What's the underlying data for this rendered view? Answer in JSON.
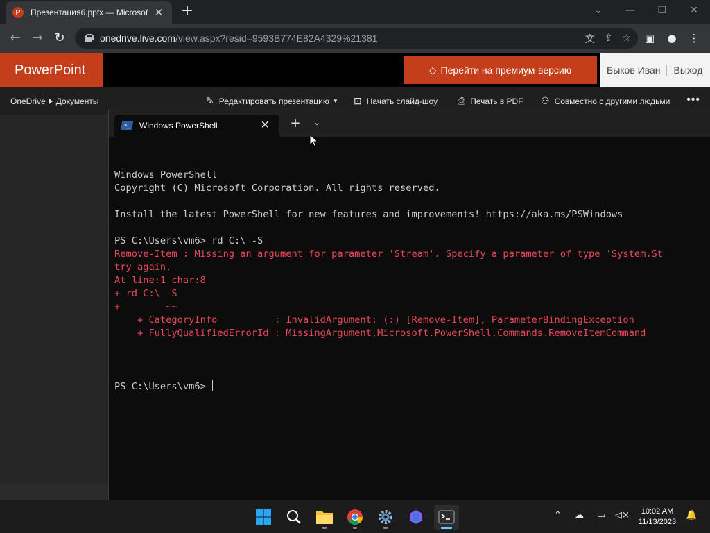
{
  "browser": {
    "tab_title": "Презентация6.pptx — Microsoft",
    "favicon_letter": "P",
    "url_host": "onedrive.live.com",
    "url_path": "/view.aspx?resid=9593B774E82A4329%21381"
  },
  "ppt": {
    "brand": "PowerPoint",
    "premium_label": "Перейти на премиум-версию",
    "user_name": "Быков Иван",
    "logout_label": "Выход"
  },
  "commandbar": {
    "breadcrumb": [
      "OneDrive",
      "Документы"
    ],
    "edit_label": "Редактировать презентацию",
    "slideshow_label": "Начать слайд-шоу",
    "print_label": "Печать в PDF",
    "share_label": "Совместно с другими людьми"
  },
  "terminal": {
    "tab_title": "Windows PowerShell",
    "lines": [
      {
        "text": "Windows PowerShell",
        "color": "w"
      },
      {
        "text": "Copyright (C) Microsoft Corporation. All rights reserved.",
        "color": "w"
      },
      {
        "text": "",
        "color": "w"
      },
      {
        "text": "Install the latest PowerShell for new features and improvements! https://aka.ms/PSWindows",
        "color": "w"
      },
      {
        "text": "",
        "color": "w"
      },
      {
        "text": "PS C:\\Users\\vm6> rd C:\\ -S",
        "color": "w"
      },
      {
        "text": "Remove-Item : Missing an argument for parameter 'Stream'. Specify a parameter of type 'System.St",
        "color": "r"
      },
      {
        "text": "try again.",
        "color": "r"
      },
      {
        "text": "At line:1 char:8",
        "color": "r"
      },
      {
        "text": "+ rd C:\\ -S",
        "color": "r"
      },
      {
        "text": "+        ~~",
        "color": "r"
      },
      {
        "text": "    + CategoryInfo          : InvalidArgument: (:) [Remove-Item], ParameterBindingException",
        "color": "r"
      },
      {
        "text": "    + FullyQualifiedErrorId : MissingArgument,Microsoft.PowerShell.Commands.RemoveItemCommand",
        "color": "r"
      },
      {
        "text": "",
        "color": "w"
      }
    ],
    "prompt": "PS C:\\Users\\vm6> "
  },
  "taskbar": {
    "time": "10:02 AM",
    "date": "11/13/2023"
  },
  "colors": {
    "ppt_accent": "#c43e1c",
    "terminal_bg": "#0c0c0c",
    "error_text": "#e74856",
    "taskbar_active": "#60cdff"
  }
}
